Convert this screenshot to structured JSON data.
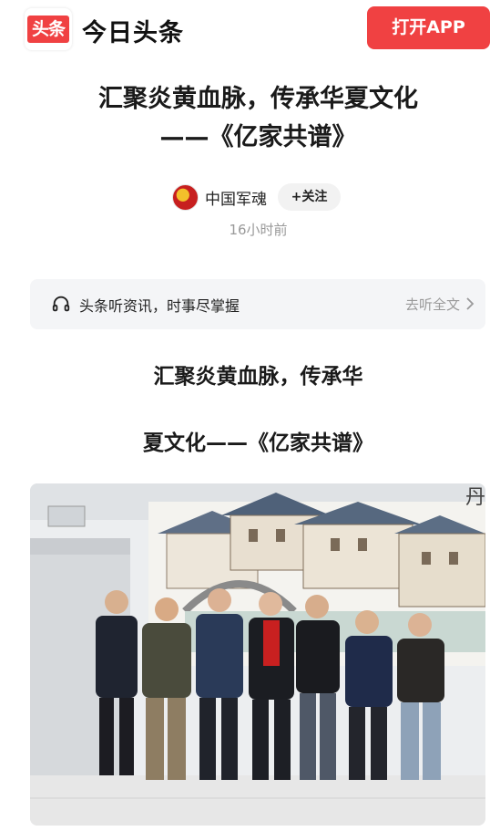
{
  "header": {
    "logo_text": "头条",
    "app_name": "今日头条",
    "open_app_label": "打开APP",
    "brand_color": "#f04142"
  },
  "article": {
    "title_line1": "汇聚炎黄血脉，传承华夏文化",
    "title_line2": "——《亿家共谱》",
    "author": "中国军魂",
    "follow_label": "+关注",
    "time": "16小时前",
    "body_title_line1": "汇聚炎黄血脉，传承华",
    "body_title_line2": "夏文化——《亿家共谱》"
  },
  "listen_bar": {
    "icon": "headphone-icon",
    "text": "头条听资讯，时事尽掌握",
    "action": "去听全文"
  },
  "photo": {
    "description_icon": "group-photo",
    "wall_sign_text": "丹"
  }
}
